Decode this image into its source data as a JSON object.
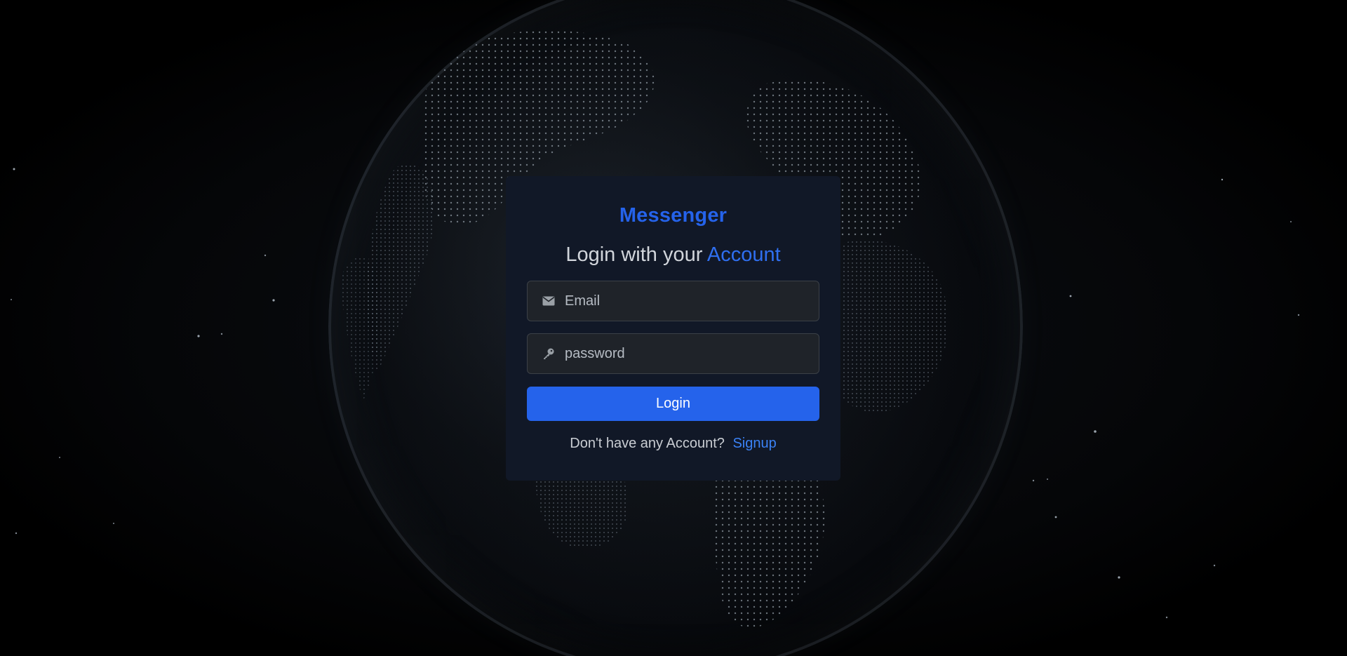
{
  "brand": {
    "name": "Messenger",
    "color": "#2563eb"
  },
  "heading": {
    "prefix": "Login with your ",
    "accent": "Account"
  },
  "form": {
    "email": {
      "placeholder": "Email",
      "value": "",
      "icon": "envelope-icon"
    },
    "password": {
      "placeholder": "password",
      "value": "",
      "icon": "key-icon"
    },
    "submit_label": "Login"
  },
  "footer": {
    "prompt": "Don't have any Account?",
    "link_label": "Signup"
  },
  "colors": {
    "card_bg": "#111827",
    "accent": "#2563eb",
    "background": "#000000"
  }
}
